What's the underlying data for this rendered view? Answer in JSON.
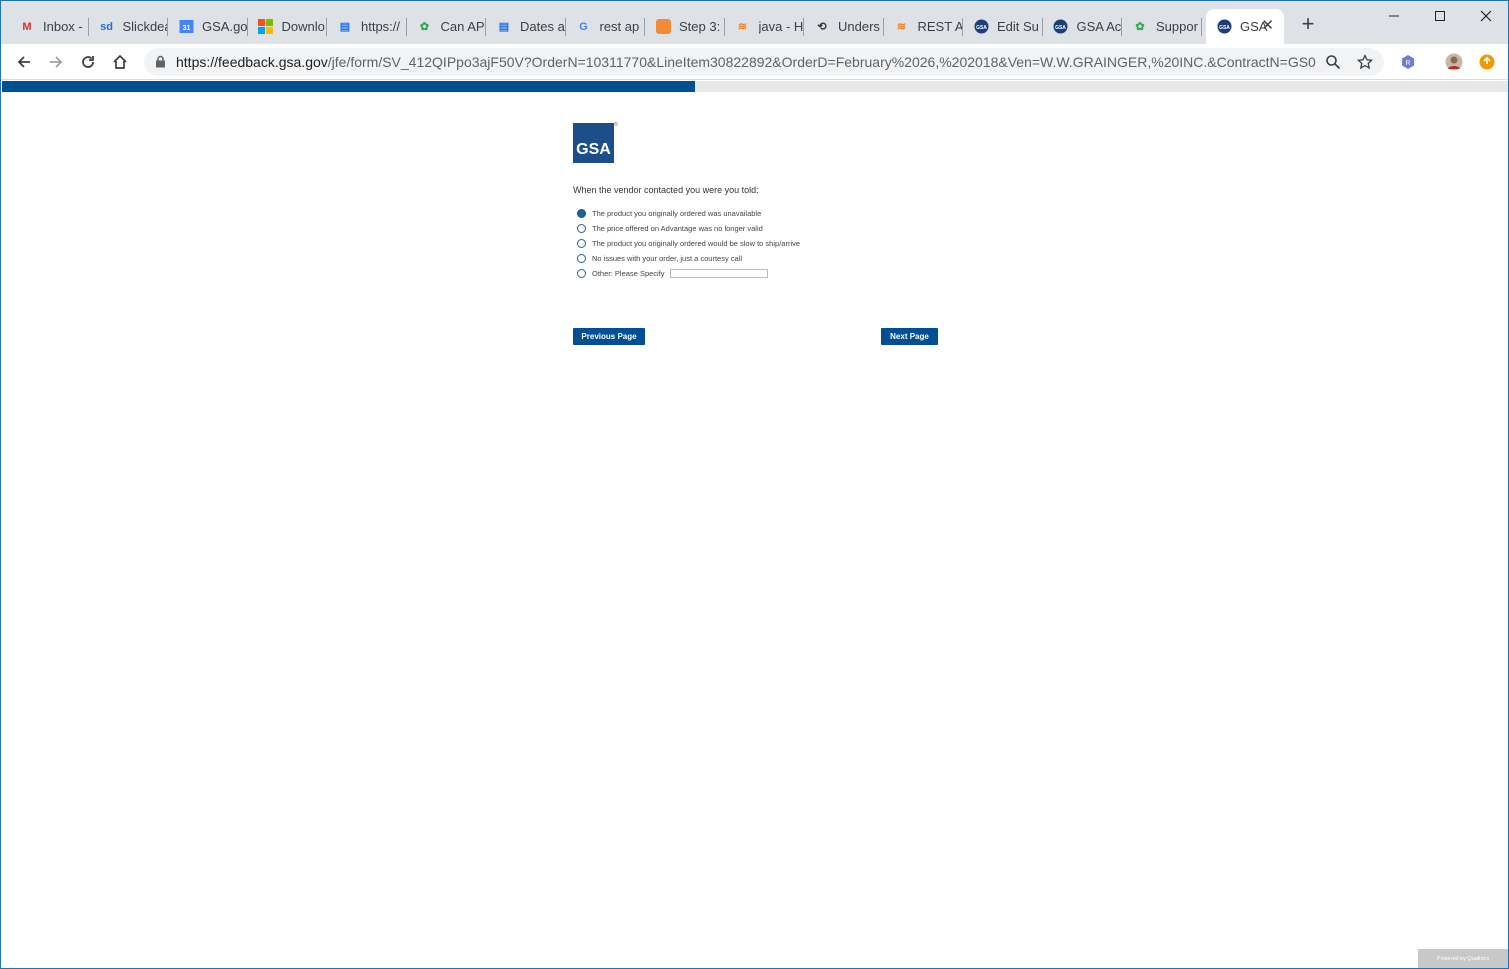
{
  "browser": {
    "tabs": [
      {
        "title": "Inbox -",
        "icon": "gmail-icon",
        "icon_glyph": "M",
        "icon_color": "#d93025"
      },
      {
        "title": "Slickdea",
        "icon": "slickdeals-icon",
        "icon_glyph": "sd",
        "icon_color": "#1a73e8"
      },
      {
        "title": "GSA.go",
        "icon": "calendar-icon",
        "icon_glyph": "31",
        "icon_color": "#4285f4"
      },
      {
        "title": "Downlo",
        "icon": "microsoft-icon",
        "icon_glyph": "▦",
        "icon_color": "#f25022"
      },
      {
        "title": "https://",
        "icon": "book-icon",
        "icon_glyph": "▤",
        "icon_color": "#1a73e8"
      },
      {
        "title": "Can AP",
        "icon": "community-icon",
        "icon_glyph": "✿",
        "icon_color": "#34a853"
      },
      {
        "title": "Dates a",
        "icon": "book-icon",
        "icon_glyph": "▤",
        "icon_color": "#1a73e8"
      },
      {
        "title": "rest ap",
        "icon": "google-icon",
        "icon_glyph": "G",
        "icon_color": "#4285f4"
      },
      {
        "title": "Step 3:",
        "icon": "orange-square-icon",
        "icon_glyph": "■",
        "icon_color": "#f28b38"
      },
      {
        "title": "java - H",
        "icon": "stackoverflow-icon",
        "icon_glyph": "≋",
        "icon_color": "#f48024"
      },
      {
        "title": "Unders",
        "icon": "link-icon",
        "icon_glyph": "⟲",
        "icon_color": "#333333"
      },
      {
        "title": "REST A",
        "icon": "stackoverflow-icon",
        "icon_glyph": "≋",
        "icon_color": "#f48024"
      },
      {
        "title": "Edit Su",
        "icon": "gsa-seal-icon",
        "icon_glyph": "GSA",
        "icon_color": "#1c3f7a"
      },
      {
        "title": "GSA Ac",
        "icon": "gsa-seal-icon",
        "icon_glyph": "GSA",
        "icon_color": "#1c3f7a"
      },
      {
        "title": "Suppor",
        "icon": "community-icon",
        "icon_glyph": "✿",
        "icon_color": "#34a853"
      },
      {
        "title": "GSA",
        "icon": "gsa-seal-icon",
        "icon_glyph": "GSA",
        "icon_color": "#1c3f7a",
        "active": true
      }
    ],
    "new_tab": "+",
    "window_controls": {
      "minimize": "—",
      "maximize": "☐",
      "close": "✕"
    },
    "url_host": "https://feedback.gsa.gov",
    "url_path": "/jfe/form/SV_412QIPpo3ajF50V?OrderN=10311770&LineItem30822892&OrderD=February%2026,%202018&Ven=W.W.GRAINGER,%20INC.&ContractN=GS0..."
  },
  "survey": {
    "progress_fraction": 0.46,
    "logo_text": "GSA",
    "logo_color": "#1c4e8a",
    "question": "When the vendor contacted you were you told:",
    "choices": [
      {
        "label": "The product you originally ordered was unavailable",
        "checked": true
      },
      {
        "label": "The price offered on Advantage was no longer valid",
        "checked": false
      },
      {
        "label": "The product you originally ordered would be slow to ship/arrive",
        "checked": false
      },
      {
        "label": "No issues with your order, just a courtesy call",
        "checked": false
      },
      {
        "label": "Other: Please Specify",
        "checked": false,
        "has_input": true
      }
    ],
    "prev_button": "Previous Page",
    "next_button": "Next Page",
    "button_color": "#004f94",
    "powered_by": "Powered by Qualtrics"
  }
}
